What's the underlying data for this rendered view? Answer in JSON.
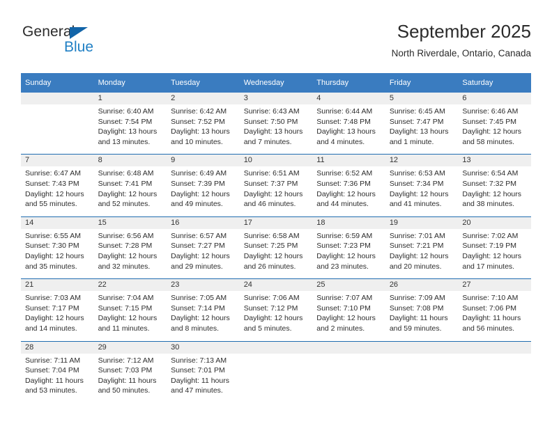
{
  "brand": {
    "name_dark": "General",
    "name_blue": "Blue",
    "accent_color": "#1f7fc4",
    "triangle_color": "#1264a8"
  },
  "header": {
    "title": "September 2025",
    "subtitle": "North Riverdale, Ontario, Canada"
  },
  "theme": {
    "header_bg": "#3a7cc0",
    "row_divider": "#1f6cb0",
    "daynum_bg": "#efefef",
    "text": "#2c2c2c"
  },
  "weekday_headers": [
    "Sunday",
    "Monday",
    "Tuesday",
    "Wednesday",
    "Thursday",
    "Friday",
    "Saturday"
  ],
  "weeks": [
    [
      {
        "day": "",
        "sunrise": "",
        "sunset": "",
        "daylight_1": "",
        "daylight_2": ""
      },
      {
        "day": "1",
        "sunrise": "Sunrise: 6:40 AM",
        "sunset": "Sunset: 7:54 PM",
        "daylight_1": "Daylight: 13 hours",
        "daylight_2": "and 13 minutes."
      },
      {
        "day": "2",
        "sunrise": "Sunrise: 6:42 AM",
        "sunset": "Sunset: 7:52 PM",
        "daylight_1": "Daylight: 13 hours",
        "daylight_2": "and 10 minutes."
      },
      {
        "day": "3",
        "sunrise": "Sunrise: 6:43 AM",
        "sunset": "Sunset: 7:50 PM",
        "daylight_1": "Daylight: 13 hours",
        "daylight_2": "and 7 minutes."
      },
      {
        "day": "4",
        "sunrise": "Sunrise: 6:44 AM",
        "sunset": "Sunset: 7:48 PM",
        "daylight_1": "Daylight: 13 hours",
        "daylight_2": "and 4 minutes."
      },
      {
        "day": "5",
        "sunrise": "Sunrise: 6:45 AM",
        "sunset": "Sunset: 7:47 PM",
        "daylight_1": "Daylight: 13 hours",
        "daylight_2": "and 1 minute."
      },
      {
        "day": "6",
        "sunrise": "Sunrise: 6:46 AM",
        "sunset": "Sunset: 7:45 PM",
        "daylight_1": "Daylight: 12 hours",
        "daylight_2": "and 58 minutes."
      }
    ],
    [
      {
        "day": "7",
        "sunrise": "Sunrise: 6:47 AM",
        "sunset": "Sunset: 7:43 PM",
        "daylight_1": "Daylight: 12 hours",
        "daylight_2": "and 55 minutes."
      },
      {
        "day": "8",
        "sunrise": "Sunrise: 6:48 AM",
        "sunset": "Sunset: 7:41 PM",
        "daylight_1": "Daylight: 12 hours",
        "daylight_2": "and 52 minutes."
      },
      {
        "day": "9",
        "sunrise": "Sunrise: 6:49 AM",
        "sunset": "Sunset: 7:39 PM",
        "daylight_1": "Daylight: 12 hours",
        "daylight_2": "and 49 minutes."
      },
      {
        "day": "10",
        "sunrise": "Sunrise: 6:51 AM",
        "sunset": "Sunset: 7:37 PM",
        "daylight_1": "Daylight: 12 hours",
        "daylight_2": "and 46 minutes."
      },
      {
        "day": "11",
        "sunrise": "Sunrise: 6:52 AM",
        "sunset": "Sunset: 7:36 PM",
        "daylight_1": "Daylight: 12 hours",
        "daylight_2": "and 44 minutes."
      },
      {
        "day": "12",
        "sunrise": "Sunrise: 6:53 AM",
        "sunset": "Sunset: 7:34 PM",
        "daylight_1": "Daylight: 12 hours",
        "daylight_2": "and 41 minutes."
      },
      {
        "day": "13",
        "sunrise": "Sunrise: 6:54 AM",
        "sunset": "Sunset: 7:32 PM",
        "daylight_1": "Daylight: 12 hours",
        "daylight_2": "and 38 minutes."
      }
    ],
    [
      {
        "day": "14",
        "sunrise": "Sunrise: 6:55 AM",
        "sunset": "Sunset: 7:30 PM",
        "daylight_1": "Daylight: 12 hours",
        "daylight_2": "and 35 minutes."
      },
      {
        "day": "15",
        "sunrise": "Sunrise: 6:56 AM",
        "sunset": "Sunset: 7:28 PM",
        "daylight_1": "Daylight: 12 hours",
        "daylight_2": "and 32 minutes."
      },
      {
        "day": "16",
        "sunrise": "Sunrise: 6:57 AM",
        "sunset": "Sunset: 7:27 PM",
        "daylight_1": "Daylight: 12 hours",
        "daylight_2": "and 29 minutes."
      },
      {
        "day": "17",
        "sunrise": "Sunrise: 6:58 AM",
        "sunset": "Sunset: 7:25 PM",
        "daylight_1": "Daylight: 12 hours",
        "daylight_2": "and 26 minutes."
      },
      {
        "day": "18",
        "sunrise": "Sunrise: 6:59 AM",
        "sunset": "Sunset: 7:23 PM",
        "daylight_1": "Daylight: 12 hours",
        "daylight_2": "and 23 minutes."
      },
      {
        "day": "19",
        "sunrise": "Sunrise: 7:01 AM",
        "sunset": "Sunset: 7:21 PM",
        "daylight_1": "Daylight: 12 hours",
        "daylight_2": "and 20 minutes."
      },
      {
        "day": "20",
        "sunrise": "Sunrise: 7:02 AM",
        "sunset": "Sunset: 7:19 PM",
        "daylight_1": "Daylight: 12 hours",
        "daylight_2": "and 17 minutes."
      }
    ],
    [
      {
        "day": "21",
        "sunrise": "Sunrise: 7:03 AM",
        "sunset": "Sunset: 7:17 PM",
        "daylight_1": "Daylight: 12 hours",
        "daylight_2": "and 14 minutes."
      },
      {
        "day": "22",
        "sunrise": "Sunrise: 7:04 AM",
        "sunset": "Sunset: 7:15 PM",
        "daylight_1": "Daylight: 12 hours",
        "daylight_2": "and 11 minutes."
      },
      {
        "day": "23",
        "sunrise": "Sunrise: 7:05 AM",
        "sunset": "Sunset: 7:14 PM",
        "daylight_1": "Daylight: 12 hours",
        "daylight_2": "and 8 minutes."
      },
      {
        "day": "24",
        "sunrise": "Sunrise: 7:06 AM",
        "sunset": "Sunset: 7:12 PM",
        "daylight_1": "Daylight: 12 hours",
        "daylight_2": "and 5 minutes."
      },
      {
        "day": "25",
        "sunrise": "Sunrise: 7:07 AM",
        "sunset": "Sunset: 7:10 PM",
        "daylight_1": "Daylight: 12 hours",
        "daylight_2": "and 2 minutes."
      },
      {
        "day": "26",
        "sunrise": "Sunrise: 7:09 AM",
        "sunset": "Sunset: 7:08 PM",
        "daylight_1": "Daylight: 11 hours",
        "daylight_2": "and 59 minutes."
      },
      {
        "day": "27",
        "sunrise": "Sunrise: 7:10 AM",
        "sunset": "Sunset: 7:06 PM",
        "daylight_1": "Daylight: 11 hours",
        "daylight_2": "and 56 minutes."
      }
    ],
    [
      {
        "day": "28",
        "sunrise": "Sunrise: 7:11 AM",
        "sunset": "Sunset: 7:04 PM",
        "daylight_1": "Daylight: 11 hours",
        "daylight_2": "and 53 minutes."
      },
      {
        "day": "29",
        "sunrise": "Sunrise: 7:12 AM",
        "sunset": "Sunset: 7:03 PM",
        "daylight_1": "Daylight: 11 hours",
        "daylight_2": "and 50 minutes."
      },
      {
        "day": "30",
        "sunrise": "Sunrise: 7:13 AM",
        "sunset": "Sunset: 7:01 PM",
        "daylight_1": "Daylight: 11 hours",
        "daylight_2": "and 47 minutes."
      },
      {
        "day": "",
        "sunrise": "",
        "sunset": "",
        "daylight_1": "",
        "daylight_2": ""
      },
      {
        "day": "",
        "sunrise": "",
        "sunset": "",
        "daylight_1": "",
        "daylight_2": ""
      },
      {
        "day": "",
        "sunrise": "",
        "sunset": "",
        "daylight_1": "",
        "daylight_2": ""
      },
      {
        "day": "",
        "sunrise": "",
        "sunset": "",
        "daylight_1": "",
        "daylight_2": ""
      }
    ]
  ]
}
